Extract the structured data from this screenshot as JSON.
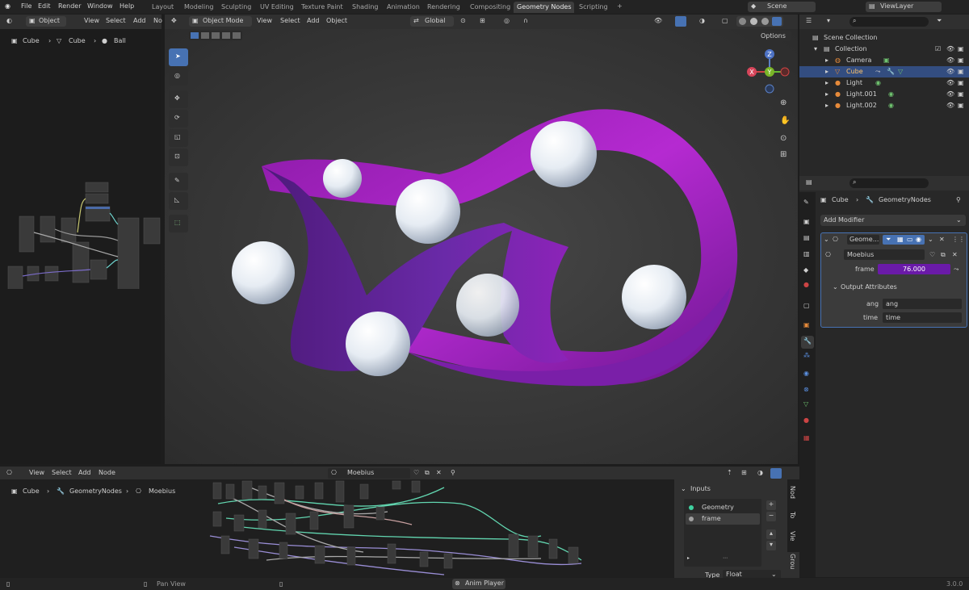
{
  "topbar": {
    "menus": [
      "File",
      "Edit",
      "Render",
      "Window",
      "Help"
    ],
    "workspaces": [
      "Layout",
      "Modeling",
      "Sculpting",
      "UV Editing",
      "Texture Paint",
      "Shading",
      "Animation",
      "Rendering",
      "Compositing",
      "Geometry Nodes",
      "Scripting"
    ],
    "active_workspace": "Geometry Nodes",
    "scene": "Scene",
    "view_layer": "ViewLayer"
  },
  "left_panel": {
    "mode": "Object",
    "menus": [
      "View",
      "Select",
      "Add",
      "No"
    ],
    "breadcrumb": [
      "Cube",
      "Cube",
      "Ball"
    ]
  },
  "viewport": {
    "mode": "Object Mode",
    "menus": [
      "View",
      "Select",
      "Add",
      "Object"
    ],
    "transform": "Global",
    "options_label": "Options",
    "gizmo": {
      "x": "X",
      "y": "Y",
      "z": "Z"
    }
  },
  "outliner": {
    "root": "Scene Collection",
    "collection": "Collection",
    "items": [
      "Camera",
      "Cube",
      "Light",
      "Light.001",
      "Light.002"
    ],
    "selected": "Cube"
  },
  "properties": {
    "breadcrumb": [
      "Cube",
      "GeometryNodes"
    ],
    "add_modifier": "Add Modifier",
    "modifier_name": "Geome...",
    "node_group": "Moebius",
    "frame_label": "frame",
    "frame_value": "76.000",
    "output_attributes": "Output Attributes",
    "outputs": [
      {
        "label": "ang",
        "value": "ang"
      },
      {
        "label": "time",
        "value": "time"
      }
    ]
  },
  "node_editor": {
    "menus": [
      "View",
      "Select",
      "Add",
      "Node"
    ],
    "node_group": "Moebius",
    "breadcrumb": [
      "Cube",
      "GeometryNodes",
      "Moebius"
    ],
    "inputs_title": "Inputs",
    "inputs": [
      "Geometry",
      "frame"
    ],
    "type_label": "Type",
    "type_value": "Float",
    "side_tabs": [
      "Nod",
      "To",
      "Vie",
      "Grou"
    ]
  },
  "status": {
    "pan_view": "Pan View",
    "anim_player": "Anim Player",
    "version": "3.0.0"
  },
  "colors": {
    "accent": "#4772b3",
    "frame_field": "#6a1aa8",
    "mobius": "#a321c4"
  }
}
